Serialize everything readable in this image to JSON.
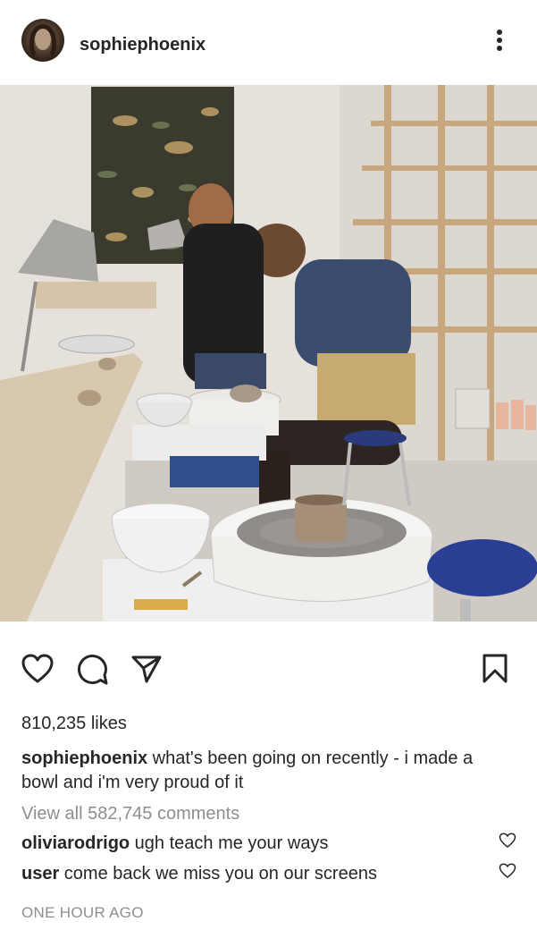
{
  "post": {
    "username": "sophiephoenix",
    "avatar_icon": "profile-avatar",
    "more_icon": "more-vertical-icon",
    "photo_alt": "pottery studio photo",
    "likes": "810,235 likes",
    "caption": {
      "username": "sophiephoenix",
      "text": " what's been going on recently - i made a bowl and i'm very proud of it"
    },
    "view_all_comments": "View all 582,745 comments",
    "comments": [
      {
        "username": "oliviarodrigo",
        "text": " ugh teach me your ways"
      },
      {
        "username": "user",
        "text": " come back we miss you on our screens"
      }
    ],
    "timestamp": "ONE HOUR AGO"
  },
  "actions": {
    "like_icon": "heart-icon",
    "comment_icon": "comment-icon",
    "share_icon": "share-icon",
    "save_icon": "bookmark-icon"
  },
  "colors": {
    "text": "#262626",
    "muted": "#8e8e8e",
    "background": "#ffffff"
  }
}
